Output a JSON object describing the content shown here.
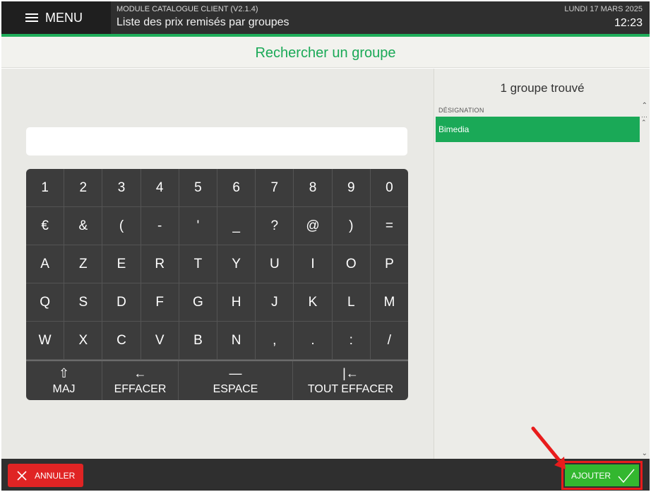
{
  "header": {
    "menu_label": "MENU",
    "module_title": "MODULE CATALOGUE CLIENT (V2.1.4)",
    "page_subtitle": "Liste des prix remisés par groupes",
    "date": "LUNDI 17 MARS 2025",
    "time": "12:23"
  },
  "title": "Rechercher un groupe",
  "search": {
    "value": ""
  },
  "keyboard": {
    "rows": [
      [
        "1",
        "2",
        "3",
        "4",
        "5",
        "6",
        "7",
        "8",
        "9",
        "0"
      ],
      [
        "€",
        "&",
        "(",
        "-",
        "'",
        "_",
        "?",
        "@",
        ")",
        "="
      ],
      [
        "A",
        "Z",
        "E",
        "R",
        "T",
        "Y",
        "U",
        "I",
        "O",
        "P"
      ],
      [
        "Q",
        "S",
        "D",
        "F",
        "G",
        "H",
        "J",
        "K",
        "L",
        "M"
      ],
      [
        "W",
        "X",
        "C",
        "V",
        "B",
        "N",
        ",",
        ".",
        ":",
        "/"
      ]
    ],
    "fn": {
      "shift_icon": "⇧",
      "shift_label": "MAJ",
      "backspace_icon": "←",
      "backspace_label": "EFFACER",
      "space_icon": "—",
      "space_label": "ESPACE",
      "clear_icon": "|←",
      "clear_label": "TOUT EFFACER"
    }
  },
  "results": {
    "count_text": "1 groupe trouvé",
    "column_header": "DÉSIGNATION",
    "items": [
      {
        "designation": "Bimedia",
        "selected": true
      }
    ]
  },
  "footer": {
    "cancel_label": "ANNULER",
    "ok_label": "AJOUTER"
  },
  "colors": {
    "accent_green": "#1aa957",
    "header_dark": "#2f2f2f",
    "cancel_red": "#e02424",
    "annotation_red": "#e81c1c"
  },
  "icons": [
    "menu-icon",
    "shift-icon",
    "backspace-icon",
    "space-icon",
    "clear-all-icon",
    "close-icon",
    "check-icon",
    "chevron-up-icon",
    "scroll-top-icon",
    "chevron-down-icon",
    "annotation-arrow"
  ]
}
